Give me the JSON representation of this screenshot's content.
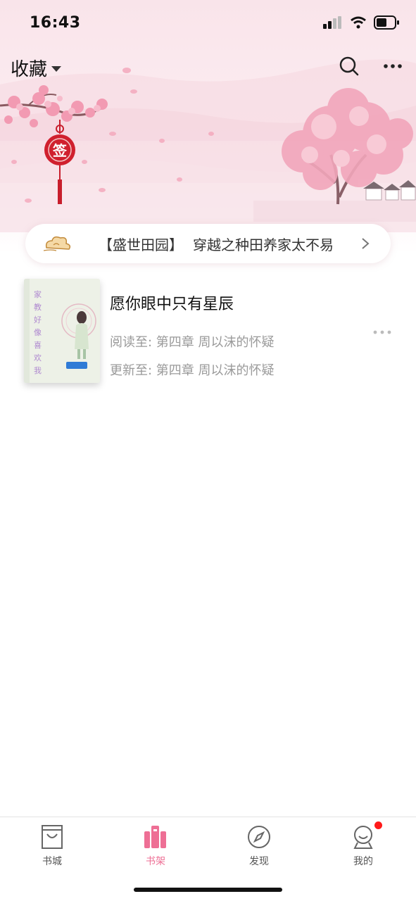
{
  "status_bar": {
    "time": "16:43"
  },
  "nav": {
    "title": "收藏"
  },
  "banner": {
    "tag": "【盛世田园】",
    "text": "穿越之种田养家太不易"
  },
  "book": {
    "title": "愿你眼中只有星辰",
    "read_progress": "阅读至: 第四章 周以沫的怀疑",
    "update_progress": "更新至: 第四章 周以沫的怀疑",
    "cover_title": "家教好像喜欢我"
  },
  "hero": {
    "charm_char": "签"
  },
  "tabs": [
    {
      "label": "书城",
      "icon": "bag-icon",
      "active": false
    },
    {
      "label": "书架",
      "icon": "books-icon",
      "active": true
    },
    {
      "label": "发现",
      "icon": "compass-icon",
      "active": false
    },
    {
      "label": "我的",
      "icon": "profile-icon",
      "active": false
    }
  ],
  "colors": {
    "accent": "#ee6f95",
    "badge": "#ff1a1a",
    "charm": "#d0202e"
  }
}
